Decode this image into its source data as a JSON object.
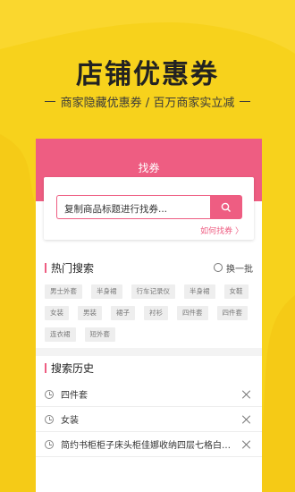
{
  "headline": "店铺优惠券",
  "subline": "商家隐藏优惠券 / 百万商家实立减",
  "colors": {
    "accent": "#ee5d82",
    "background": "#f7d21c"
  },
  "header": {
    "title": "找券"
  },
  "search": {
    "placeholder": "复制商品标题进行找券...",
    "button_icon": "search-icon",
    "how_link": "如何找券 〉"
  },
  "hot": {
    "title": "热门搜索",
    "refresh_label": "换一批",
    "tags": [
      "男士外套",
      "半身裙",
      "行车记录仪",
      "半身裙",
      "女鞋",
      "女装",
      "男装",
      "裙子",
      "衬衫",
      "四件套",
      "四件套",
      "连衣裙",
      "短外套"
    ]
  },
  "history": {
    "title": "搜索历史",
    "items": [
      "四件套",
      "女装",
      "简约书柜柜子床头柜佳娜收纳四层七格白色实..."
    ]
  }
}
